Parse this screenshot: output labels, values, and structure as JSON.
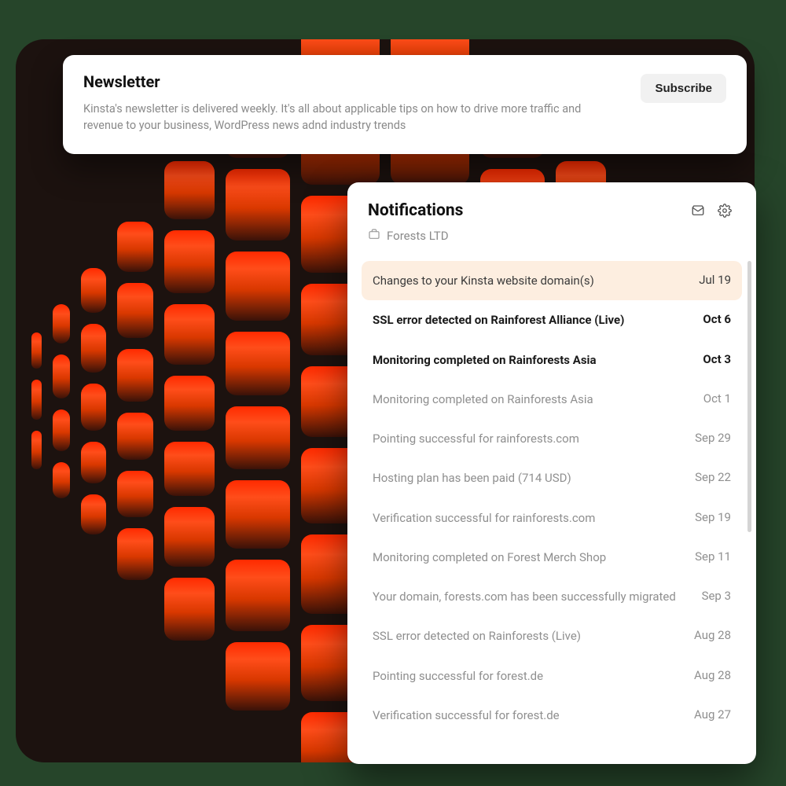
{
  "newsletter": {
    "title": "Newsletter",
    "description": "Kinsta's newsletter is delivered weekly. It's all about applicable tips on how to drive more traffic and revenue to your business, WordPress news adnd industry trends",
    "subscribe_label": "Subscribe"
  },
  "notifications": {
    "title": "Notifications",
    "org_name": "Forests LTD",
    "items": [
      {
        "message": "Changes to your Kinsta website domain(s)",
        "date": "Jul 19",
        "state": "highlight"
      },
      {
        "message": "SSL error detected on Rainforest Alliance (Live)",
        "date": "Oct 6",
        "state": "unread"
      },
      {
        "message": "Monitoring completed on Rainforests Asia",
        "date": "Oct 3",
        "state": "unread"
      },
      {
        "message": "Monitoring completed on Rainforests Asia",
        "date": "Oct 1",
        "state": "read"
      },
      {
        "message": "Pointing successful for rainforests.com",
        "date": "Sep 29",
        "state": "read"
      },
      {
        "message": "Hosting plan has been paid (714 USD)",
        "date": "Sep 22",
        "state": "read"
      },
      {
        "message": "Verification successful for rainforests.com",
        "date": "Sep 19",
        "state": "read"
      },
      {
        "message": "Monitoring completed on Forest Merch Shop",
        "date": "Sep 11",
        "state": "read"
      },
      {
        "message": "Your domain, forests.com has been successfully migrated",
        "date": "Sep 3",
        "state": "read"
      },
      {
        "message": "SSL error detected on Rainforests (Live)",
        "date": "Aug 28",
        "state": "read"
      },
      {
        "message": "Pointing successful for forest.de",
        "date": "Aug 28",
        "state": "read"
      },
      {
        "message": "Verification successful for forest.de",
        "date": "Aug 27",
        "state": "read"
      }
    ]
  }
}
